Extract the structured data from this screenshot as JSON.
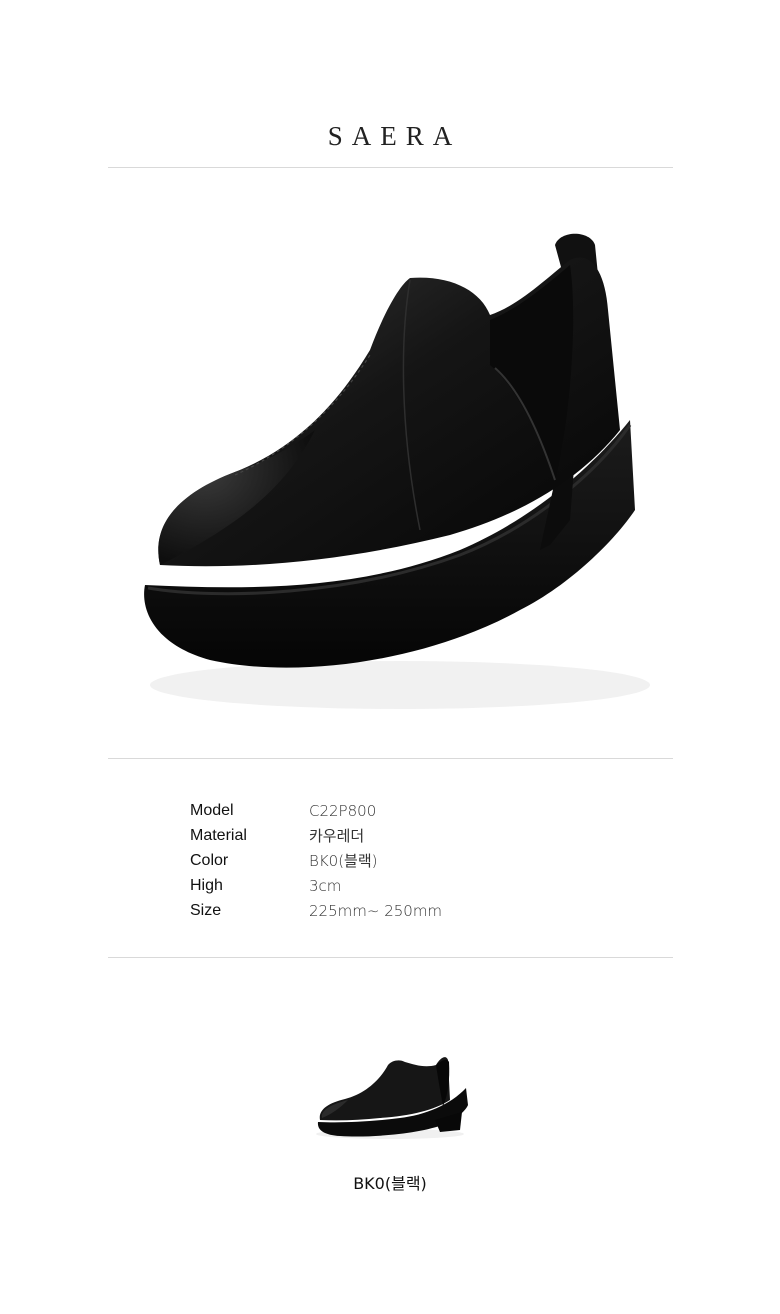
{
  "brand": {
    "name": "SAERA"
  },
  "product": {
    "image": "black-leather-chelsea-ankle-boot",
    "specs": [
      {
        "label": "Model",
        "value": "C22P800"
      },
      {
        "label": "Material",
        "value": "카우레더"
      },
      {
        "label": "Color",
        "value": "BK0(블랙)"
      },
      {
        "label": "High",
        "value": "3cm"
      },
      {
        "label": "Size",
        "value": "225mm~ 250mm"
      }
    ]
  },
  "swatch": {
    "image": "black-boot-thumbnail",
    "label": "BK0(블랙)"
  }
}
